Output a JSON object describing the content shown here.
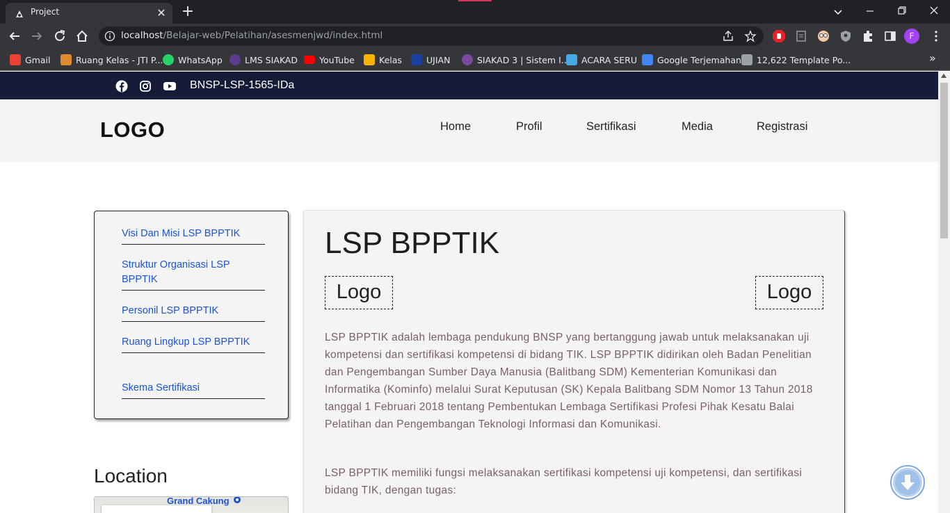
{
  "browser": {
    "tab_title": "Project",
    "url_host": "localhost",
    "url_path": "/Belajar-web/Pelatihan/asesmenjwd/index.html",
    "profile_initial": "F",
    "bookmarks": [
      {
        "label": "Gmail",
        "icon": "gmail-icon",
        "color": "#ea4335"
      },
      {
        "label": "Ruang Kelas - JTI P...",
        "icon": "ruang-kelas-icon",
        "color": "#e08a2e"
      },
      {
        "label": "WhatsApp",
        "icon": "whatsapp-icon",
        "color": "#25d366"
      },
      {
        "label": "LMS SIAKAD",
        "icon": "lms-siakad-icon",
        "color": "#5b3c8c"
      },
      {
        "label": "YouTube",
        "icon": "youtube-icon",
        "color": "#ff0000"
      },
      {
        "label": "Kelas",
        "icon": "kelas-icon",
        "color": "#f4b400"
      },
      {
        "label": "UJIAN",
        "icon": "ujian-icon",
        "color": "#1a3fa0"
      },
      {
        "label": "SIAKAD 3 | Sistem I...",
        "icon": "siakad3-icon",
        "color": "#7a4b9c"
      },
      {
        "label": "ACARA SERU",
        "icon": "acara-seru-icon",
        "color": "#47a9e6"
      },
      {
        "label": "Google Terjemahan",
        "icon": "google-translate-icon",
        "color": "#4285f4"
      },
      {
        "label": "12,622 Template Po...",
        "icon": "pt-icon",
        "color": "#9aa0a6"
      }
    ]
  },
  "page": {
    "top_label": "BNSP-LSP-1565-IDa",
    "logo": "LOGO",
    "menu": [
      "Home",
      "Profil",
      "Sertifikasi",
      "Media",
      "Registrasi"
    ],
    "sidebar_links": [
      "Visi Dan Misi LSP BPPTIK",
      "Struktur Organisasi LSP BPPTIK",
      "Personil LSP BPPTIK",
      "Ruang Lingkup LSP BPPTIK",
      "Skema Sertifikasi"
    ],
    "location_title": "Location",
    "map_label": "Grand Cakung",
    "content_title": "LSP BPPTIK",
    "logo_left": "Logo",
    "logo_right": "Logo",
    "paragraph_1": "LSP BPPTIK adalah lembaga pendukung BNSP yang bertanggung jawab untuk melaksanakan uji kompetensi dan sertifikasi kompetensi di bidang TIK. LSP BPPTIK didirikan oleh Badan Penelitian dan Pengembangan Sumber Daya Manusia (Balitbang SDM) Kementerian Komunikasi dan Informatika (Kominfo) melalui Surat Keputusan (SK) Kepala Balitbang SDM Nomor 13 Tahun 2018 tanggal 1 Februari 2018 tentang Pembentukan Lembaga Sertifikasi Profesi Pihak Kesatu Balai Pelatihan dan Pengembangan Teknologi Informasi dan Komunikasi.",
    "paragraph_2": "LSP BPPTIK memiliki fungsi melaksanakan sertifikasi kompetensi uji kompetensi, dan sertifikasi bidang TIK, dengan tugas:"
  }
}
